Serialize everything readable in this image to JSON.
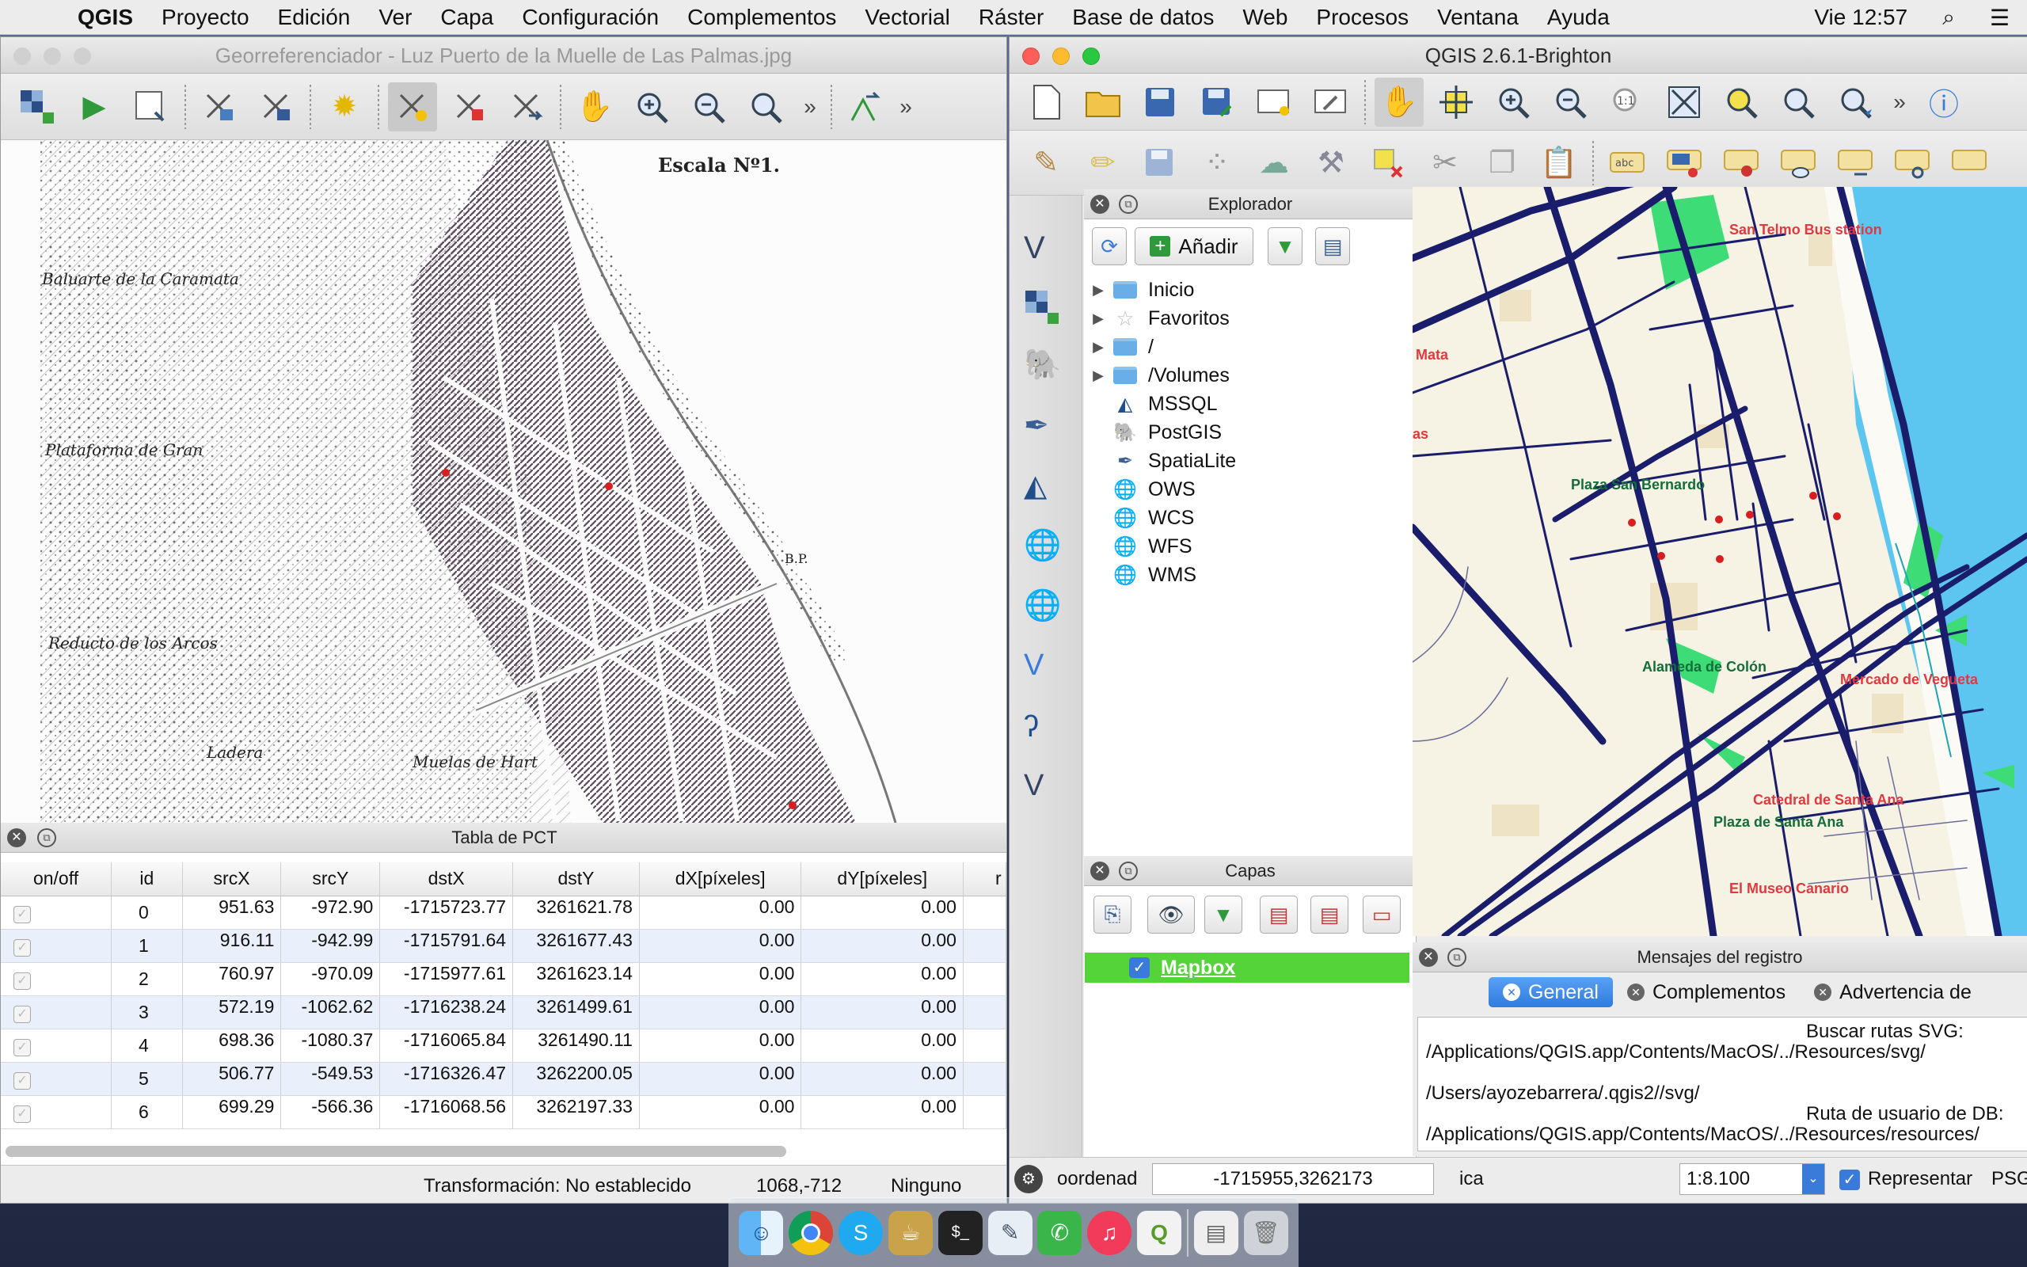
{
  "menubar": {
    "app_name": "QGIS",
    "items": [
      "Proyecto",
      "Edición",
      "Ver",
      "Capa",
      "Configuración",
      "Complementos",
      "Vectorial",
      "Ráster",
      "Base de datos",
      "Web",
      "Procesos",
      "Ventana",
      "Ayuda"
    ],
    "clock": "Vie 12:57"
  },
  "georef_window": {
    "title": "Georreferenciador - Luz Puerto de la Muelle de Las Palmas.jpg",
    "map_labels": {
      "scale": "Escala Nº1.",
      "baluarte": "Baluarte de la Caramata",
      "plataforma": "Plataforma de Gran",
      "reducto": "Reducto de los Arcos",
      "ladera": "Ladera",
      "muelas": "Muelas de Hart",
      "point_label": "B.P."
    },
    "gcp_panel": {
      "title": "Tabla de PCT",
      "columns": [
        "on/off",
        "id",
        "srcX",
        "srcY",
        "dstX",
        "dstY",
        "dX[píxeles]",
        "dY[píxeles]",
        "r"
      ],
      "rows": [
        {
          "id": "0",
          "srcX": "951.63",
          "srcY": "-972.90",
          "dstX": "-1715723.77",
          "dstY": "3261621.78",
          "dX": "0.00",
          "dY": "0.00"
        },
        {
          "id": "1",
          "srcX": "916.11",
          "srcY": "-942.99",
          "dstX": "-1715791.64",
          "dstY": "3261677.43",
          "dX": "0.00",
          "dY": "0.00"
        },
        {
          "id": "2",
          "srcX": "760.97",
          "srcY": "-970.09",
          "dstX": "-1715977.61",
          "dstY": "3261623.14",
          "dX": "0.00",
          "dY": "0.00"
        },
        {
          "id": "3",
          "srcX": "572.19",
          "srcY": "-1062.62",
          "dstX": "-1716238.24",
          "dstY": "3261499.61",
          "dX": "0.00",
          "dY": "0.00"
        },
        {
          "id": "4",
          "srcX": "698.36",
          "srcY": "-1080.37",
          "dstX": "-1716065.84",
          "dstY": "3261490.11",
          "dX": "0.00",
          "dY": "0.00"
        },
        {
          "id": "5",
          "srcX": "506.77",
          "srcY": "-549.53",
          "dstX": "-1716326.47",
          "dstY": "3262200.05",
          "dX": "0.00",
          "dY": "0.00"
        },
        {
          "id": "6",
          "srcX": "699.29",
          "srcY": "-566.36",
          "dstX": "-1716068.56",
          "dstY": "3262197.33",
          "dX": "0.00",
          "dY": "0.00"
        }
      ]
    },
    "status": {
      "transform": "Transformación: No establecido",
      "coords": "1068,-712",
      "crs": "Ninguno"
    }
  },
  "qgis_window": {
    "title": "QGIS 2.6.1-Brighton",
    "explorer": {
      "title": "Explorador",
      "add_label": "Añadir",
      "items": [
        {
          "label": "Inicio",
          "icon": "folder-icon",
          "expandable": true
        },
        {
          "label": "Favoritos",
          "icon": "star-icon",
          "expandable": true
        },
        {
          "label": "/",
          "icon": "folder-icon",
          "expandable": true
        },
        {
          "label": "/Volumes",
          "icon": "folder-icon",
          "expandable": true
        },
        {
          "label": "MSSQL",
          "icon": "mssql-icon",
          "expandable": false
        },
        {
          "label": "PostGIS",
          "icon": "postgis-icon",
          "expandable": false
        },
        {
          "label": "SpatiaLite",
          "icon": "spatialite-icon",
          "expandable": false
        },
        {
          "label": "OWS",
          "icon": "globe-icon",
          "expandable": false
        },
        {
          "label": "WCS",
          "icon": "globe-icon",
          "expandable": false
        },
        {
          "label": "WFS",
          "icon": "globe-icon",
          "expandable": false
        },
        {
          "label": "WMS",
          "icon": "globe-icon",
          "expandable": false
        }
      ]
    },
    "layers": {
      "title": "Capas",
      "items": [
        {
          "label": "Mapbox",
          "checked": true
        }
      ]
    },
    "map_labels": {
      "san_telmo": "San Telmo Bus station",
      "mata": "Mata",
      "as": "as",
      "plaza_san_bernardo": "Plaza San Bernardo",
      "alameda": "Alameda de Colón",
      "mercado": "Mercado de Vegueta",
      "catedral": "Catedral de Santa Ana",
      "plaza_santa_ana": "Plaza de Santa Ana",
      "museo": "El Museo Canario"
    },
    "log": {
      "title": "Mensajes del registro",
      "tabs": [
        "General",
        "Complementos",
        "Advertencia de"
      ],
      "lines": [
        "Buscar rutas SVG:",
        "/Applications/QGIS.app/Contents/MacOS/../Resources/svg/",
        "/Users/ayozebarrera/.qgis2//svg/",
        "Ruta de usuario de DB:",
        "/Applications/QGIS.app/Contents/MacOS/../Resources/resources/"
      ]
    },
    "statusbar": {
      "coord_label": "oordenad",
      "coord_value": "-1715955,3262173",
      "scale_label": "ica",
      "scale_value": "1:8.100",
      "render_label": "Representar",
      "epsg": "PSG"
    }
  },
  "colors": {
    "layer_highlight": "#55d43a",
    "tab_active": "#2f7ce0",
    "road": "#1a1d6b",
    "water": "#5cc6f0",
    "park": "#3ddc77",
    "label_red": "#e2383f"
  }
}
